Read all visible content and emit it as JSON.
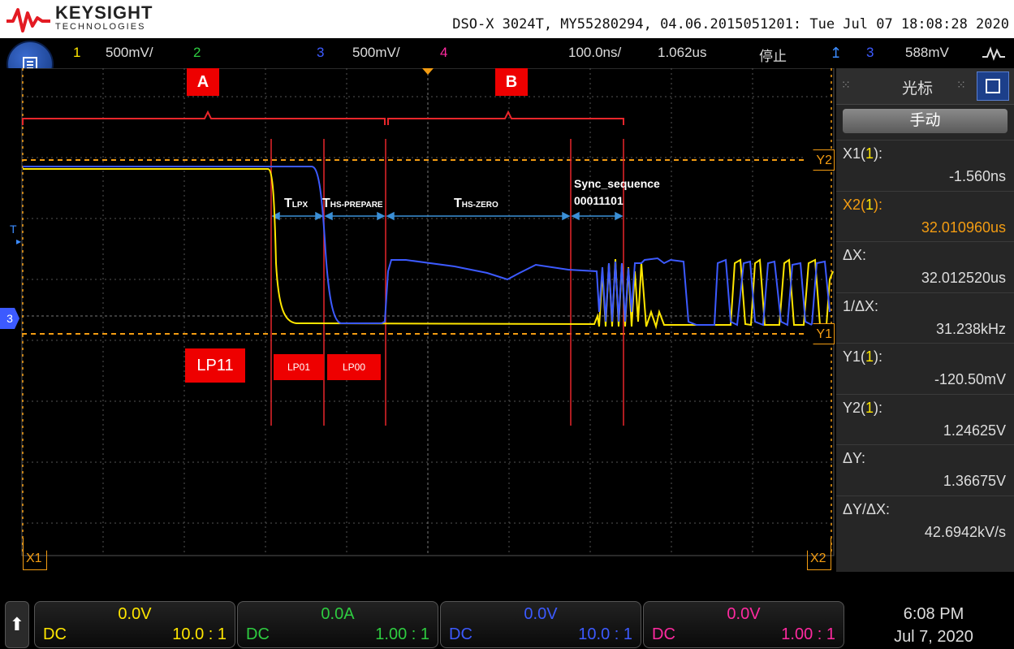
{
  "header": {
    "brand": "KEYSIGHT",
    "brand_sub": "TECHNOLOGIES",
    "device_info": "DSO-X 3024T, MY55280294, 04.06.2015051201: Tue Jul 07 18:08:28 2020"
  },
  "topbar": {
    "ch1_num": "1",
    "ch1_scale": "500mV/",
    "ch2_num": "2",
    "ch3_num": "3",
    "ch3_scale": "500mV/",
    "ch4_num": "4",
    "timebase": "100.0ns/",
    "delay": "1.062us",
    "run_state": "停止",
    "trigger_channel": "3",
    "trigger_level": "588mV",
    "colors": {
      "ch1": "#ffe600",
      "ch2": "#2ecc40",
      "ch3": "#3c5aff",
      "ch4": "#ff2aa0",
      "trigger": "#3c8cff"
    }
  },
  "annotations": {
    "A": "A",
    "B": "B",
    "LP11": "LP11",
    "LP01": "LP01",
    "LP00": "LP00",
    "tlpx_main": "T",
    "tlpx_sub": "LPX",
    "ths_prep_main": "T",
    "ths_prep_sub": "HS-PREPARE",
    "ths_zero_main": "T",
    "ths_zero_sub": "HS-ZERO",
    "sync_line1": "Sync_sequence",
    "sync_line2": "00011101"
  },
  "markers": {
    "y2": "Y2",
    "y1": "Y1",
    "x1": "X1",
    "x2": "X2",
    "trig": "T",
    "ch3": "3"
  },
  "cursor_panel": {
    "title": "光标",
    "mode": "手动",
    "rows": [
      {
        "key_pre": "X1(",
        "key_ch": "1",
        "key_post": "):",
        "value": "-1.560ns",
        "highlight": false
      },
      {
        "key_pre": "X2(",
        "key_ch": "1",
        "key_post": "):",
        "value": "32.010960us",
        "highlight": true
      },
      {
        "key_pre": "ΔX:",
        "key_ch": "",
        "key_post": "",
        "value": "32.012520us",
        "highlight": false
      },
      {
        "key_pre": "1/ΔX:",
        "key_ch": "",
        "key_post": "",
        "value": "31.238kHz",
        "highlight": false
      },
      {
        "key_pre": "Y1(",
        "key_ch": "1",
        "key_post": "):",
        "value": "-120.50mV",
        "highlight": false
      },
      {
        "key_pre": "Y2(",
        "key_ch": "1",
        "key_post": "):",
        "value": "1.24625V",
        "highlight": false
      },
      {
        "key_pre": "ΔY:",
        "key_ch": "",
        "key_post": "",
        "value": "1.36675V",
        "highlight": false
      },
      {
        "key_pre": "ΔY/ΔX:",
        "key_ch": "",
        "key_post": "",
        "value": "42.6942kV/s",
        "highlight": false
      }
    ]
  },
  "channels": [
    {
      "offset": "0.0V",
      "coupling": "DC",
      "probe": "10.0 : 1",
      "color": "#ffe600"
    },
    {
      "offset": "0.0A",
      "coupling": "DC",
      "probe": "1.00 : 1",
      "color": "#2ecc40"
    },
    {
      "offset": "0.0V",
      "coupling": "DC",
      "probe": "10.0 : 1",
      "color": "#3c5aff"
    },
    {
      "offset": "0.0V",
      "coupling": "DC",
      "probe": "1.00 : 1",
      "color": "#ff2aa0"
    }
  ],
  "clock": {
    "time": "6:08 PM",
    "date": "Jul 7, 2020"
  }
}
